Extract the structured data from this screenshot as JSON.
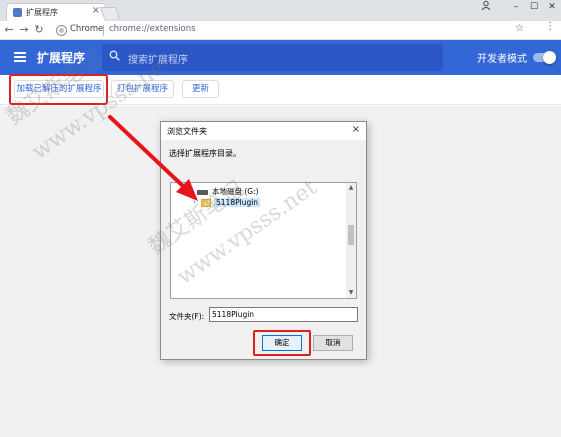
{
  "browser": {
    "tab_title": "扩展程序",
    "tab_close": "×",
    "omnibox_site": "Chrome",
    "omnibox_url": "chrome://extensions"
  },
  "extensions": {
    "title": "扩展程序",
    "search_placeholder": "搜索扩展程序",
    "developer_mode_label": "开发者模式",
    "developer_mode_on": true
  },
  "toolbar": {
    "load_unpacked": "加载已解压的扩展程序",
    "pack_extension": "打包扩展程序",
    "update": "更新"
  },
  "dialog": {
    "title": "浏览文件夹",
    "close": "×",
    "prompt": "选择扩展程序目录。",
    "tree": [
      {
        "label": "本地磁盘 (G:)",
        "type": "drive"
      },
      {
        "label": "5118Plugin",
        "type": "folder",
        "selected": true
      }
    ],
    "folder_label": "文件夹(F):",
    "folder_value": "5118Plugin",
    "ok": "确定",
    "cancel": "取消"
  },
  "watermark": {
    "line1": "魏艾斯笔记",
    "line2": "www.vpsss.net"
  },
  "colors": {
    "header_blue": "#3367d6",
    "highlight_red": "#e02020"
  }
}
